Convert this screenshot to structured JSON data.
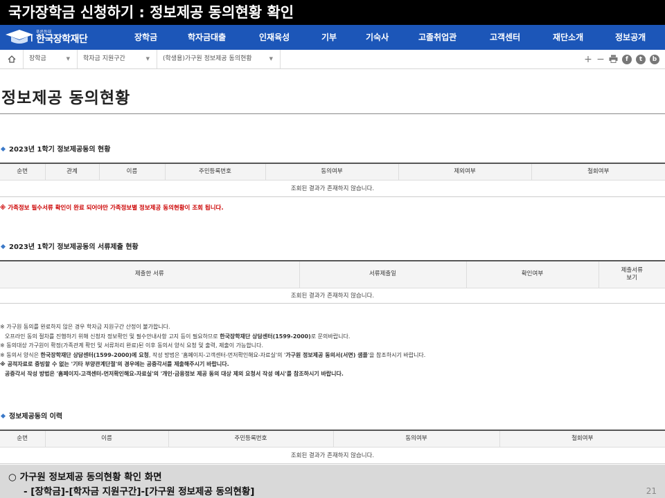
{
  "slide_title": "국가장학금 신청하기 : 정보제공 동의현황 확인",
  "logo": {
    "sub": "푸른등대",
    "main": "한국장학재단",
    "icon": "graduation-cap-icon"
  },
  "gnb": [
    "장학금",
    "학자금대출",
    "인재육성",
    "기부",
    "기숙사",
    "고졸취업관",
    "고객센터",
    "재단소개",
    "정보공개"
  ],
  "breadcrumb": [
    "장학금",
    "학자금 지원구간",
    "(학생용)가구원 정보제공 동의현황"
  ],
  "tools": {
    "plus": "+",
    "minus": "−",
    "print": "print-icon",
    "facebook": "f",
    "twitter": "t",
    "blog": "b"
  },
  "page_title": "정보제공 동의현황",
  "section1": {
    "title": "2023년 1학기 정보제공동의 현황",
    "headers": [
      "순번",
      "관계",
      "이름",
      "주민등록번호",
      "동의여부",
      "제외여부",
      "철회여부"
    ],
    "empty": "조회된 결과가 존재하지 않습니다."
  },
  "warning": "※ 가족정보 필수서류 확인이 완료 되어야만 가족정보별 정보제공 동의현황이 조회 됩니다.",
  "section2": {
    "title": "2023년 1학기 정보제공동의 서류제출 현황",
    "headers": [
      "제출한 서류",
      "서류제출일",
      "확인여부"
    ],
    "header_last_1": "제출서류",
    "header_last_2": "보기",
    "empty": "조회된 결과가 존재하지 않습니다."
  },
  "notes": {
    "n1": "※ 가구원 동의를 완료하지 않은 경우 학자금 지원구간 산정이 불가합니다.",
    "n2a": "오프라인 동의 절차를 진행하기 위해 신청자 정보확인 및 필수안내사항 고지 등이 필요하므로 ",
    "n2b": "한국장학재단 상담센터(1599-2000)",
    "n2c": "로 문의바랍니다.",
    "n3": "※ 동의대상 가구원이 확정(가족관계 확인 및 서류처리 완료)된 이후 동의서 양식 요청 및 출력, 제출이 가능합니다.",
    "n4a": "※ 동의서 양식은 ",
    "n4b": "한국장학재단 상담센터(1599-2000)에 요청",
    "n4c": ", 작성 방법은 '홈페이지-고객센터-먼저확인해요-자료실'의 '",
    "n4d": "가구원 정보제공 동의서(서면) 샘플",
    "n4e": "'을 참조하시기 바랍니다.",
    "n5a": "※ 공적자료로 증빙할 수 없는 '기타 부양관계단절'의 경우에는 ",
    "n5b": "공증각서를 제출해주시기 바랍니다.",
    "n6a": "공증각서 작성 방법은 '홈페이지-고객센터-먼저확인해요-자료실'의 '",
    "n6b": "개인·금융정보 제공 동의 대상 제외 요청서 작성 예시",
    "n6c": "'를 참조하시기 바랍니다."
  },
  "section3": {
    "title": "정보제공동의 이력",
    "headers": [
      "순번",
      "이름",
      "주민등록번호",
      "동의여부",
      "철회여부"
    ],
    "empty": "조회된 결과가 존재하지 않습니다."
  },
  "caption": {
    "line1": "○ 가구원 정보제공 동의현황 확인 화면",
    "line2": "- [장학금]-[학자금 지원구간]-[가구원 정보제공 동의현황]"
  },
  "page_number": "21",
  "colors": {
    "gnb": "#1c56b8",
    "warning": "#cc0000",
    "diamond": "#3b79c8"
  }
}
